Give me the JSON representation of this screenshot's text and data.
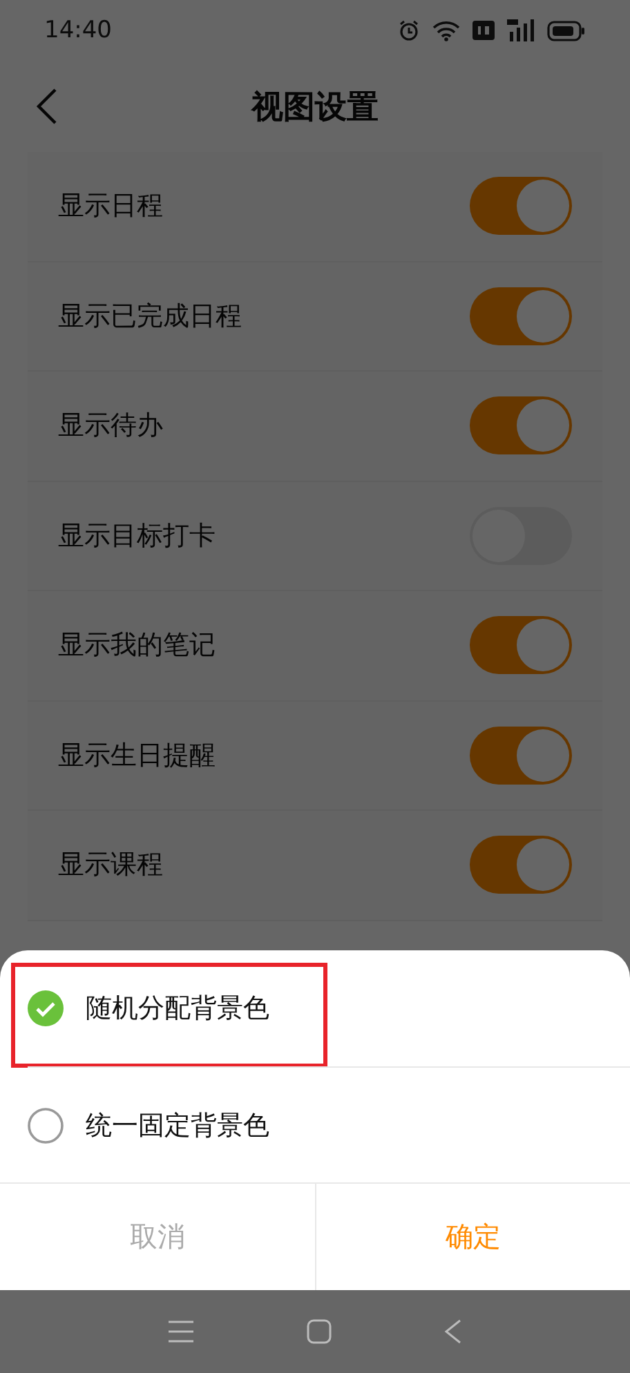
{
  "status_bar": {
    "time": "14:40"
  },
  "header": {
    "title": "视图设置"
  },
  "settings": [
    {
      "label": "显示日程",
      "on": true
    },
    {
      "label": "显示已完成日程",
      "on": true
    },
    {
      "label": "显示待办",
      "on": true
    },
    {
      "label": "显示目标打卡",
      "on": false
    },
    {
      "label": "显示我的笔记",
      "on": true
    },
    {
      "label": "显示生日提醒",
      "on": true
    },
    {
      "label": "显示课程",
      "on": true
    }
  ],
  "sheet": {
    "options": [
      {
        "label": "随机分配背景色",
        "selected": true,
        "highlighted": true
      },
      {
        "label": "统一固定背景色",
        "selected": false,
        "highlighted": false
      }
    ],
    "buttons": [
      {
        "label": "取消",
        "kind": "cancel"
      },
      {
        "label": "确定",
        "kind": "confirm"
      }
    ]
  }
}
